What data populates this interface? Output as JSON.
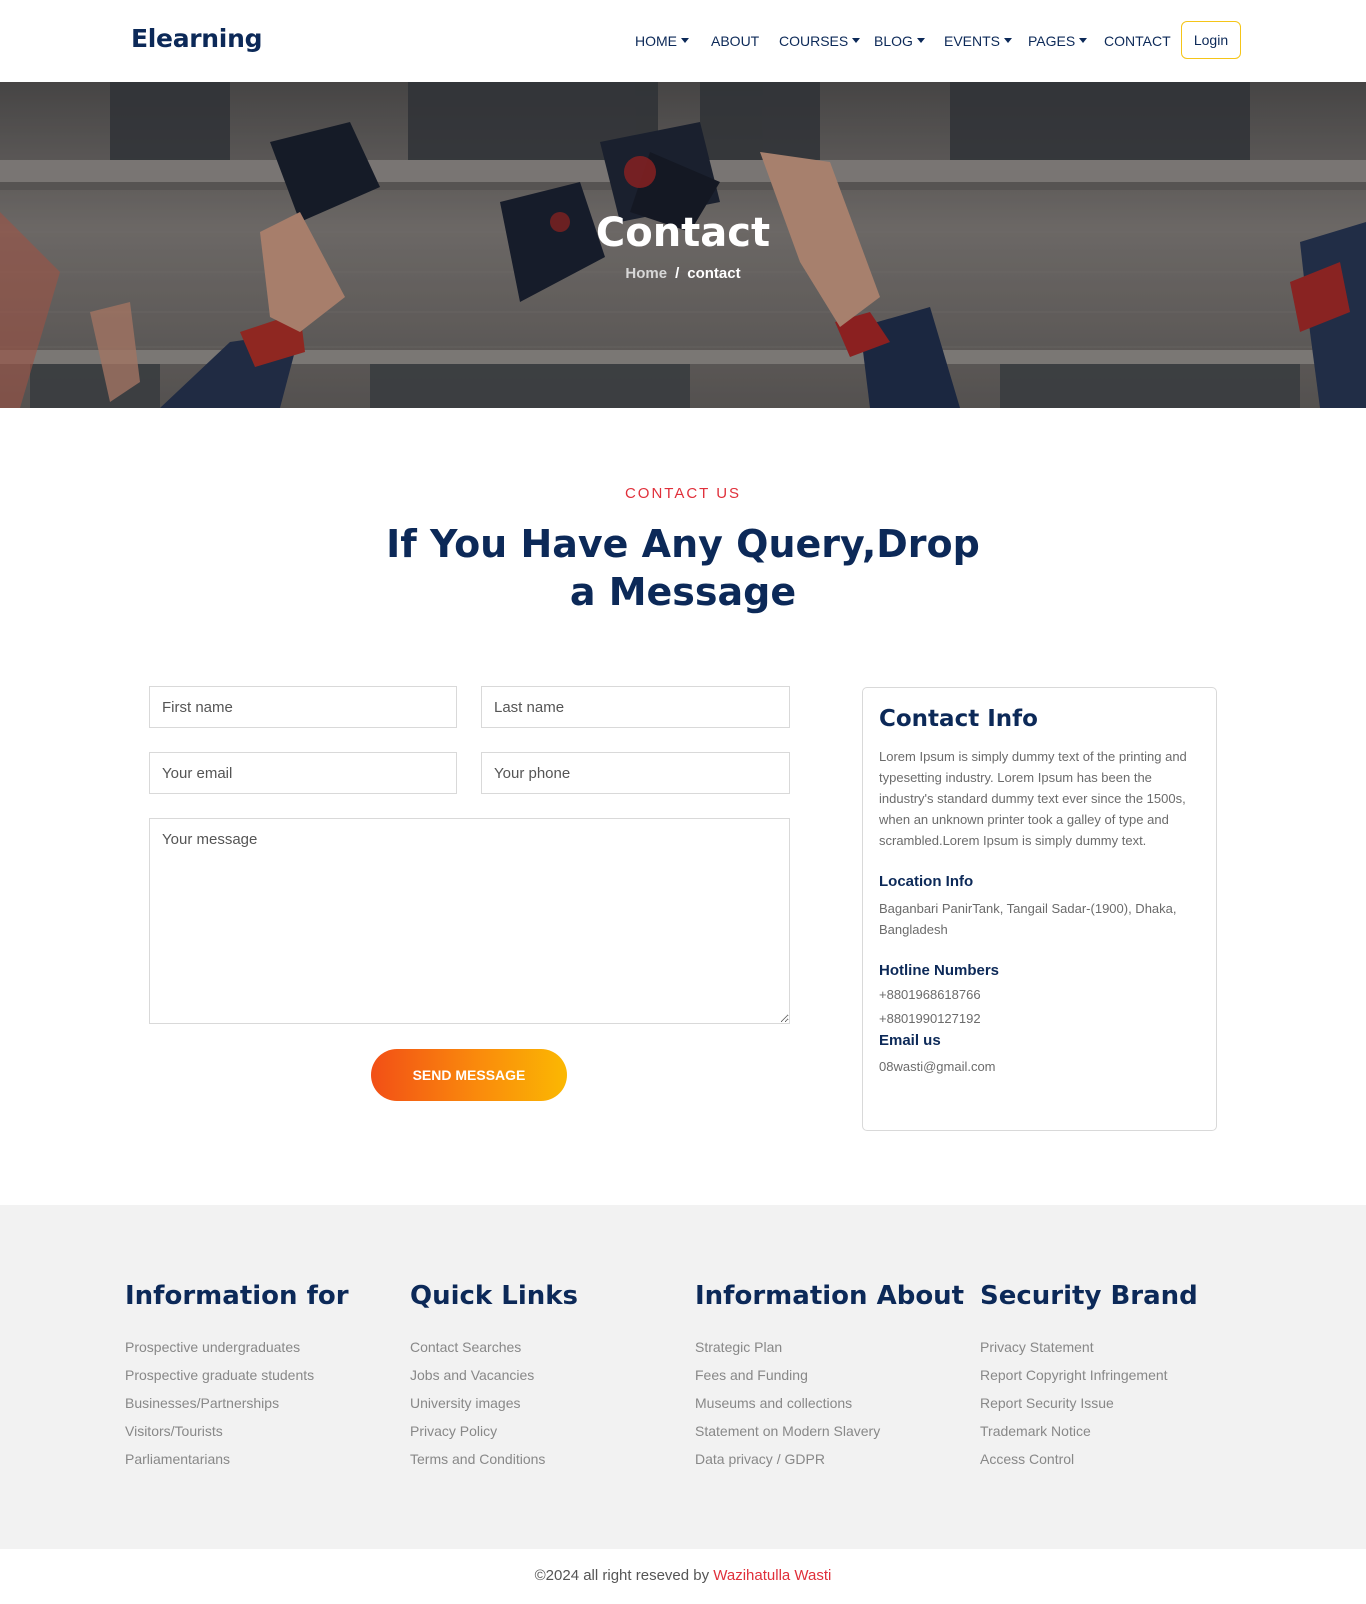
{
  "brand": "Elearning",
  "nav": {
    "items": [
      {
        "label": "HOME",
        "dropdown": true
      },
      {
        "label": "ABOUT",
        "dropdown": false
      },
      {
        "label": "COURSES",
        "dropdown": true
      },
      {
        "label": "BLOG",
        "dropdown": true
      },
      {
        "label": "EVENTS",
        "dropdown": true
      },
      {
        "label": "PAGES",
        "dropdown": true
      },
      {
        "label": "CONTACT",
        "dropdown": false
      }
    ],
    "login": "Login"
  },
  "hero": {
    "title": "Contact",
    "breadcrumb": {
      "home": "Home",
      "separator": "/",
      "current": "contact"
    }
  },
  "section": {
    "eyebrow": "CONTACT US",
    "headline_line1": "If You Have Any Query,Drop",
    "headline_line2": "a Message"
  },
  "form": {
    "first_name_placeholder": "First name",
    "last_name_placeholder": "Last name",
    "email_placeholder": "Your email",
    "phone_placeholder": "Your phone",
    "message_placeholder": "Your message",
    "submit": "SEND MESSAGE"
  },
  "contact_info": {
    "title": "Contact Info",
    "description": "Lorem Ipsum is simply dummy text of the printing and typesetting industry. Lorem Ipsum has been the industry's standard dummy text ever since the 1500s, when an unknown printer took a galley of type and scrambled.Lorem Ipsum is simply dummy text.",
    "location_title": "Location Info",
    "location": "Baganbari PanirTank, Tangail Sadar-(1900), Dhaka, Bangladesh",
    "hotline_title": "Hotline Numbers",
    "phones": [
      "+8801968618766",
      "+8801990127192"
    ],
    "email_title": "Email us",
    "email": "08wasti@gmail.com"
  },
  "footer": {
    "columns": [
      {
        "title": "Information for",
        "links": [
          "Prospective undergraduates",
          "Prospective graduate students",
          "Businesses/Partnerships",
          "Visitors/Tourists",
          "Parliamentarians"
        ]
      },
      {
        "title": "Quick Links",
        "links": [
          "Contact Searches",
          "Jobs and Vacancies",
          "University images",
          "Privacy Policy",
          "Terms and Conditions"
        ]
      },
      {
        "title": "Information About",
        "links": [
          "Strategic Plan",
          "Fees and Funding",
          "Museums and collections",
          "Statement on Modern Slavery",
          "Data privacy / GDPR"
        ]
      },
      {
        "title": "Security Brand",
        "links": [
          "Privacy Statement",
          "Report Copyright Infringement",
          "Report Security Issue",
          "Trademark Notice",
          "Access Control"
        ]
      }
    ],
    "copyright_prefix": "©2024 all right reseved by ",
    "copyright_author": "Wazihatulla Wasti"
  },
  "colors": {
    "navy": "#0c2958",
    "accent_red": "#e0303b",
    "login_border": "#f5c518",
    "button_gradient": [
      "#f24f16",
      "#fbb802"
    ],
    "footer_bg": "#f2f2f2"
  }
}
